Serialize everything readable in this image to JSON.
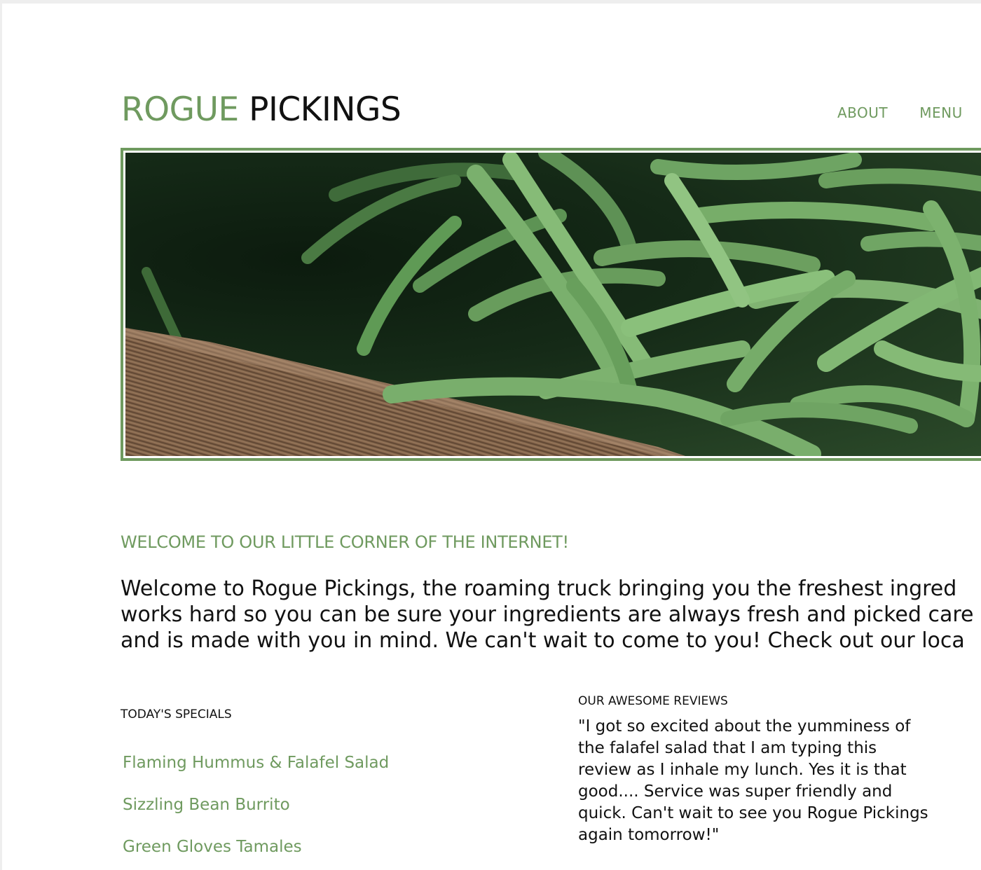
{
  "brand": {
    "word1": "ROGUE",
    "word2": "PICKINGS",
    "accent_color": "#6f9a5f"
  },
  "nav": {
    "items": [
      "ABOUT",
      "MENU"
    ]
  },
  "hero": {
    "description_icon": "green-beans-photo"
  },
  "welcome": {
    "heading": "WELCOME TO OUR LITTLE CORNER OF THE INTERNET!",
    "lines": [
      "Welcome to Rogue Pickings, the roaming truck bringing you the freshest ingred",
      "works hard so you can be sure your ingredients are always fresh and picked care",
      "and is made with you in mind. We can't wait to come to you! Check out our loca"
    ]
  },
  "specials": {
    "heading": "TODAY'S SPECIALS",
    "items": [
      "Flaming Hummus & Falafel Salad",
      "Sizzling Bean Burrito",
      "Green Gloves Tamales"
    ]
  },
  "reviews": {
    "heading": "OUR AWESOME REVIEWS",
    "text": "\"I got so excited about the yumminess of the falafel salad that I am typing this review as I inhale my lunch. Yes it is that good.... Service was super friendly and quick. Can't wait to see you Rogue Pickings again tomorrow!\""
  }
}
